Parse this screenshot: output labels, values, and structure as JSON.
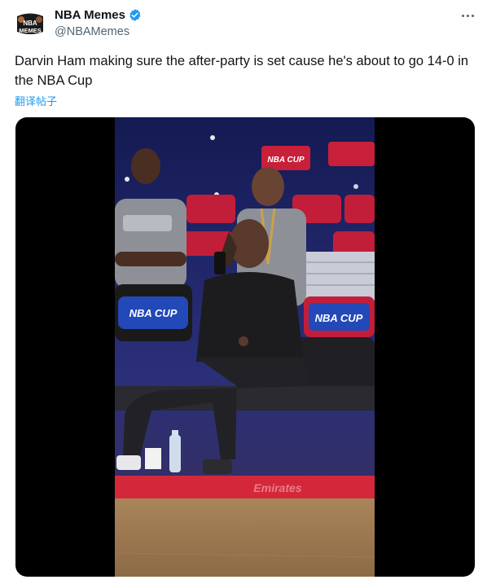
{
  "author": {
    "name": "NBA Memes",
    "handle": "@NBAMemes",
    "avatar_logo_line1": "NBA",
    "avatar_logo_line2": "MEMES"
  },
  "post": {
    "text": "Darvin Ham making sure the after-party is set cause he's about to go 14-0 in the NBA Cup",
    "translate_label": "翻译帖子"
  },
  "media": {
    "type": "video",
    "signage": {
      "nba_cup": "NBA CUP",
      "emirates": "Emirates"
    }
  },
  "icons": {
    "verified": "verified-badge-icon",
    "more": "more-options-icon"
  },
  "colors": {
    "accent": "#1d9bf0",
    "text": "#0f1419",
    "secondary": "#536471",
    "media_bg": "#000000"
  }
}
